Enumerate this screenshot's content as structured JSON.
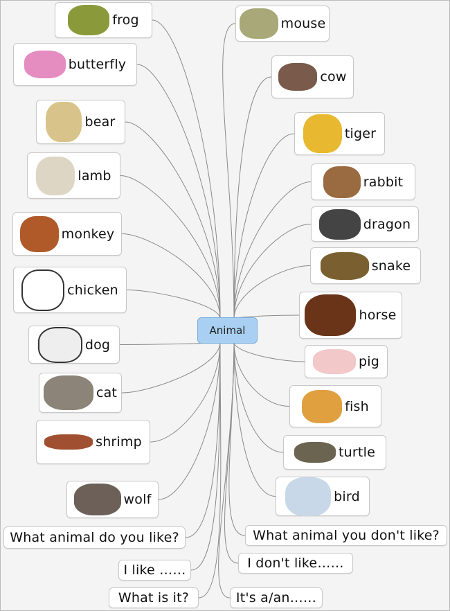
{
  "center": {
    "label": "Animal",
    "color": "#a9d0f2"
  },
  "left_nodes": [
    {
      "label": "frog",
      "image": "frog"
    },
    {
      "label": "butterfly",
      "image": "butterfly"
    },
    {
      "label": "bear",
      "image": "teddy-bear"
    },
    {
      "label": "lamb",
      "image": "lamb"
    },
    {
      "label": "monkey",
      "image": "monkey"
    },
    {
      "label": "chicken",
      "image": "chicken"
    },
    {
      "label": "dog",
      "image": "dalmatian-dog"
    },
    {
      "label": "cat",
      "image": "cat"
    },
    {
      "label": "shrimp",
      "image": "shrimp"
    },
    {
      "label": "wolf",
      "image": "wolves"
    },
    {
      "label": "What animal do you like?"
    },
    {
      "label": "I like ……"
    },
    {
      "label": "What is it?"
    }
  ],
  "right_nodes": [
    {
      "label": "mouse",
      "image": "mouse"
    },
    {
      "label": "cow",
      "image": "cow"
    },
    {
      "label": "tiger",
      "image": "tiger"
    },
    {
      "label": "rabbit",
      "image": "rabbit"
    },
    {
      "label": "dragon",
      "image": "dragon"
    },
    {
      "label": "snake",
      "image": "snake"
    },
    {
      "label": "horse",
      "image": "horse"
    },
    {
      "label": "pig",
      "image": "pig"
    },
    {
      "label": "fish",
      "image": "fish"
    },
    {
      "label": "turtle",
      "image": "turtle"
    },
    {
      "label": "bird",
      "image": "bird"
    },
    {
      "label": "What animal you don't like?"
    },
    {
      "label": "I don't like……"
    },
    {
      "label": "It's a/an……"
    }
  ]
}
